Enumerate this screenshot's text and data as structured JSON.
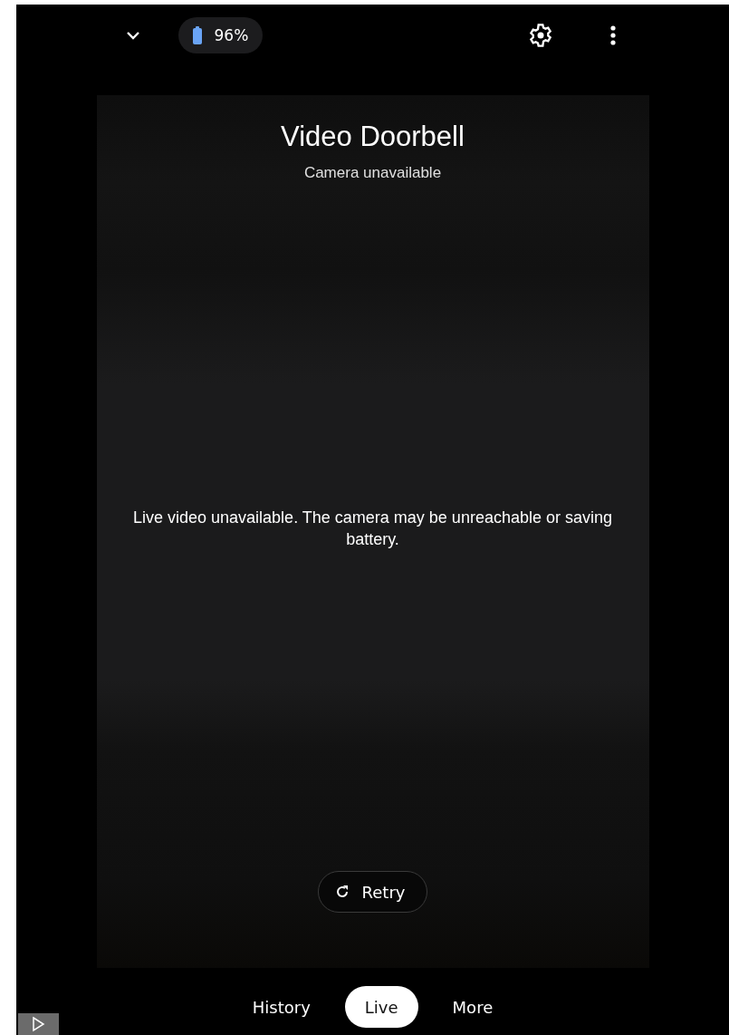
{
  "top_bar": {
    "battery": "96%"
  },
  "camera": {
    "title": "Video Doorbell",
    "subtitle": "Camera unavailable",
    "message": "Live video unavailable. The camera may be unreachable or saving battery.",
    "retry": "Retry"
  },
  "tabs": [
    {
      "label": "History",
      "selected": false
    },
    {
      "label": "Live",
      "selected": true
    },
    {
      "label": "More",
      "selected": false
    }
  ]
}
